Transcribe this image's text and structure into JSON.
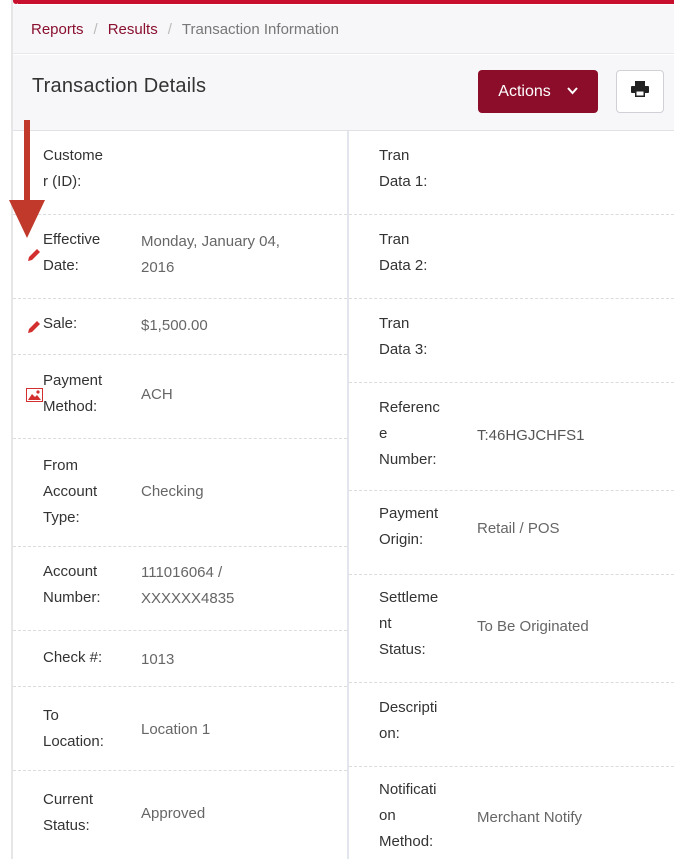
{
  "breadcrumb": {
    "items": [
      "Reports",
      "Results",
      "Transaction Information"
    ]
  },
  "header": {
    "title": "Transaction Details",
    "actions_label": "Actions",
    "actions_chevron": "⌄",
    "print_icon": "printer-icon"
  },
  "left_fields": [
    {
      "label": "Custome r (ID):",
      "label_lines": [
        "Custome",
        "r (ID):"
      ],
      "value_lines": []
    },
    {
      "label_lines": [
        "Effective",
        "Date:"
      ],
      "value_lines": [
        "Monday, January 04,",
        "2016"
      ],
      "icon": "pencil-icon"
    },
    {
      "label_lines": [
        "Sale:"
      ],
      "value_lines": [
        "$1,500.00"
      ],
      "icon": "pencil-icon"
    },
    {
      "label_lines": [
        "Payment",
        "Method:"
      ],
      "value_lines": [
        "ACH"
      ],
      "icon": "image-icon"
    },
    {
      "label_lines": [
        "From",
        "Account",
        "Type:"
      ],
      "value_lines": [
        "Checking"
      ]
    },
    {
      "label_lines": [
        "Account",
        "Number:"
      ],
      "value_lines": [
        "111016064 /",
        "XXXXXX4835"
      ]
    },
    {
      "label_lines": [
        "Check #:"
      ],
      "value_lines": [
        "1013"
      ]
    },
    {
      "label_lines": [
        "To",
        "Location:"
      ],
      "value_lines": [
        "Location 1"
      ]
    },
    {
      "label_lines": [
        "Current",
        "Status:"
      ],
      "value_lines": [
        "Approved"
      ]
    }
  ],
  "right_fields": [
    {
      "label_lines": [
        "Tran",
        "Data 1:"
      ],
      "value_lines": []
    },
    {
      "label_lines": [
        "Tran",
        "Data 2:"
      ],
      "value_lines": []
    },
    {
      "label_lines": [
        "Tran",
        "Data 3:"
      ],
      "value_lines": []
    },
    {
      "label_lines": [
        "Referenc",
        "e",
        "Number:"
      ],
      "value_lines": [
        "T:46HGJCHFS1"
      ]
    },
    {
      "label_lines": [
        "Payment",
        "Origin:"
      ],
      "value_lines": [
        "Retail / POS"
      ]
    },
    {
      "label_lines": [
        "Settleme",
        "nt",
        "Status:"
      ],
      "value_lines": [
        "To Be Originated"
      ]
    },
    {
      "label_lines": [
        "Descripti",
        "on:"
      ],
      "value_lines": []
    },
    {
      "label_lines": [
        "Notificati",
        "on",
        "Method:"
      ],
      "value_lines": [
        "Merchant Notify"
      ]
    }
  ],
  "colors": {
    "accent": "#8b0d2a",
    "link": "#8a1030",
    "icon_red": "#d32f2f",
    "annotation_arrow": "#c0392b"
  }
}
